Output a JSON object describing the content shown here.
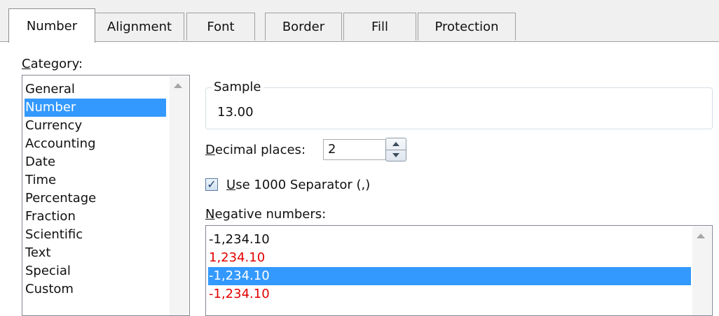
{
  "tabs": [
    {
      "label": "Number",
      "active": true
    },
    {
      "label": "Alignment",
      "active": false
    },
    {
      "label": "Font",
      "active": false
    },
    {
      "label": "Border",
      "active": false
    },
    {
      "label": "Fill",
      "active": false
    },
    {
      "label": "Protection",
      "active": false
    }
  ],
  "category": {
    "label_first": "C",
    "label_rest": "ategory:",
    "items": [
      "General",
      "Number",
      "Currency",
      "Accounting",
      "Date",
      "Time",
      "Percentage",
      "Fraction",
      "Scientific",
      "Text",
      "Special",
      "Custom"
    ],
    "selected": "Number"
  },
  "sample": {
    "legend": "Sample",
    "value": "13.00"
  },
  "decimal_places": {
    "label_first": "D",
    "label_rest": "ecimal places:",
    "value": "2"
  },
  "separator": {
    "checked": true,
    "label_first": "U",
    "label_rest": "se 1000 Separator (,)"
  },
  "negative_numbers": {
    "label_first": "N",
    "label_rest": "egative numbers:",
    "items": [
      {
        "text": "-1,234.10",
        "color": "#111111"
      },
      {
        "text": "1,234.10",
        "color": "#e00000"
      },
      {
        "text": "-1,234.10",
        "color": "#ffffff",
        "selected": true
      },
      {
        "text": "-1,234.10",
        "color": "#e00000"
      }
    ]
  },
  "colors": {
    "selection": "#3399ff",
    "negative_red": "#e00000"
  }
}
